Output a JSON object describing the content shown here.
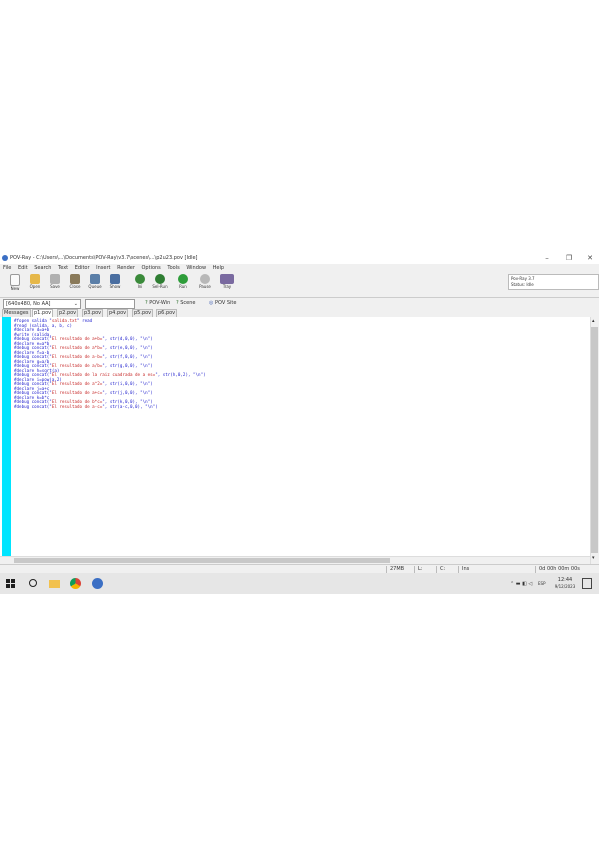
{
  "window": {
    "title": "POV-Ray - C:\\Users\\...\\Documents\\POV-Ray\\v3.7\\scenes\\...\\p2u23.pov [Idle]",
    "controls": [
      "–",
      "❐",
      "✕"
    ]
  },
  "menu": [
    "File",
    "Edit",
    "Search",
    "Text",
    "Editor",
    "Insert",
    "Render",
    "Options",
    "Tools",
    "Window",
    "Help"
  ],
  "toolbar": {
    "buttons": [
      {
        "label": "New",
        "icon": "new-file-icon",
        "color": "#f0f0f0"
      },
      {
        "label": "Open",
        "icon": "open-folder-icon",
        "color": "#e6b84a"
      },
      {
        "label": "Save",
        "icon": "save-icon",
        "color": "#b0b0b0"
      },
      {
        "label": "Close",
        "icon": "close-file-icon",
        "color": "#8a7a5a"
      },
      {
        "label": "Queue",
        "icon": "queue-icon",
        "color": "#5b7fa8"
      },
      {
        "label": "Show",
        "icon": "show-icon",
        "color": "#4a6ea0"
      },
      {
        "label": "Ini",
        "icon": "ini-icon",
        "color": "#3a8a3a"
      },
      {
        "label": "Sel-Run",
        "icon": "sel-run-icon",
        "color": "#2e7d32"
      },
      {
        "label": "Run",
        "icon": "run-icon",
        "color": "#2e9d3a"
      },
      {
        "label": "Pause",
        "icon": "pause-icon",
        "color": "#b8b8b8"
      },
      {
        "label": "Tray",
        "icon": "tray-icon",
        "color": "#7a6aa0"
      }
    ],
    "status_box": [
      "Pov-Ray 3.7",
      "Status: Idle"
    ]
  },
  "options": {
    "resolution": "[640x480, No AA]",
    "command_field": "",
    "links": [
      "POV-Win",
      "Scene",
      "POV Site"
    ]
  },
  "tabs": [
    "Messages",
    "p1.pov",
    "p2.pov",
    "p3.pov",
    "p4.pov",
    "p5.pov",
    "p6.pov"
  ],
  "active_tab": 1,
  "code": [
    {
      "a": "#fopen salida \"",
      "s": "salida.txt",
      "b": "\" read"
    },
    {
      "a": "#read (salida, a, b, c)",
      "s": "",
      "b": ""
    },
    {
      "a": "#declare d=a+b",
      "s": "",
      "b": ""
    },
    {
      "a": "#write (salida,",
      "s": "",
      "b": ""
    },
    {
      "a": "#debug concat(\"",
      "s": "El resultado de a+b=",
      "b": "\", str(d,0,0), \"\\n\")"
    },
    {
      "a": "#declare e=a*b",
      "s": "",
      "b": ""
    },
    {
      "a": "#debug concat(\"",
      "s": "El resultado de a*b=",
      "b": "\", str(e,0,0), \"\\n\")"
    },
    {
      "a": "#declare f=a-b",
      "s": "",
      "b": ""
    },
    {
      "a": "#debug concat(\"",
      "s": "El resultado de a-b=",
      "b": "\", str(f,0,0), \"\\n\")"
    },
    {
      "a": "#declare g=a/b",
      "s": "",
      "b": ""
    },
    {
      "a": "#debug concat(\"",
      "s": "El resultado de a/b=",
      "b": "\", str(g,0,0), \"\\n\")"
    },
    {
      "a": "#declare h=sqrt(a)",
      "s": "",
      "b": ""
    },
    {
      "a": "#debug concat(\"",
      "s": "El resultado de la raiz cuadrada de a es=",
      "b": "\", str(h,0,2), \"\\n\")"
    },
    {
      "a": "#declare i=pow(a,2)",
      "s": "",
      "b": ""
    },
    {
      "a": "#debug concat(\"",
      "s": "El resultado de a^2=",
      "b": "\", str(i,0,0), \"\\n\")"
    },
    {
      "a": "#declare j=a+c",
      "s": "",
      "b": ""
    },
    {
      "a": "#debug concat(\"",
      "s": "El resultado de a+c=",
      "b": "\", str(j,0,0), \"\\n\")"
    },
    {
      "a": "#declare k=b*c",
      "s": "",
      "b": ""
    },
    {
      "a": "#debug concat(\"",
      "s": "El resultado de b*c=",
      "b": "\", str(k,0,0), \"\\n\")"
    },
    {
      "a": "#debug concat(\"",
      "s": "El resultado de a-c=",
      "b": "\", str(a-c,0,0), \"\\n\")"
    }
  ],
  "status": {
    "memory": "27MB",
    "line": "L:",
    "col": "C:",
    "ins": "Ins",
    "time": "0d 00h 00m 00s"
  },
  "taskbar": {
    "icons": [
      "windows-start-icon",
      "search-icon",
      "file-explorer-icon",
      "chrome-icon",
      "povray-icon"
    ],
    "time": "12:44",
    "date": "9/12/2023",
    "lang": "ESP"
  },
  "colors": {
    "gutter": "#00e5ff",
    "keyword": "#1a1acc",
    "string": "#c62828"
  }
}
